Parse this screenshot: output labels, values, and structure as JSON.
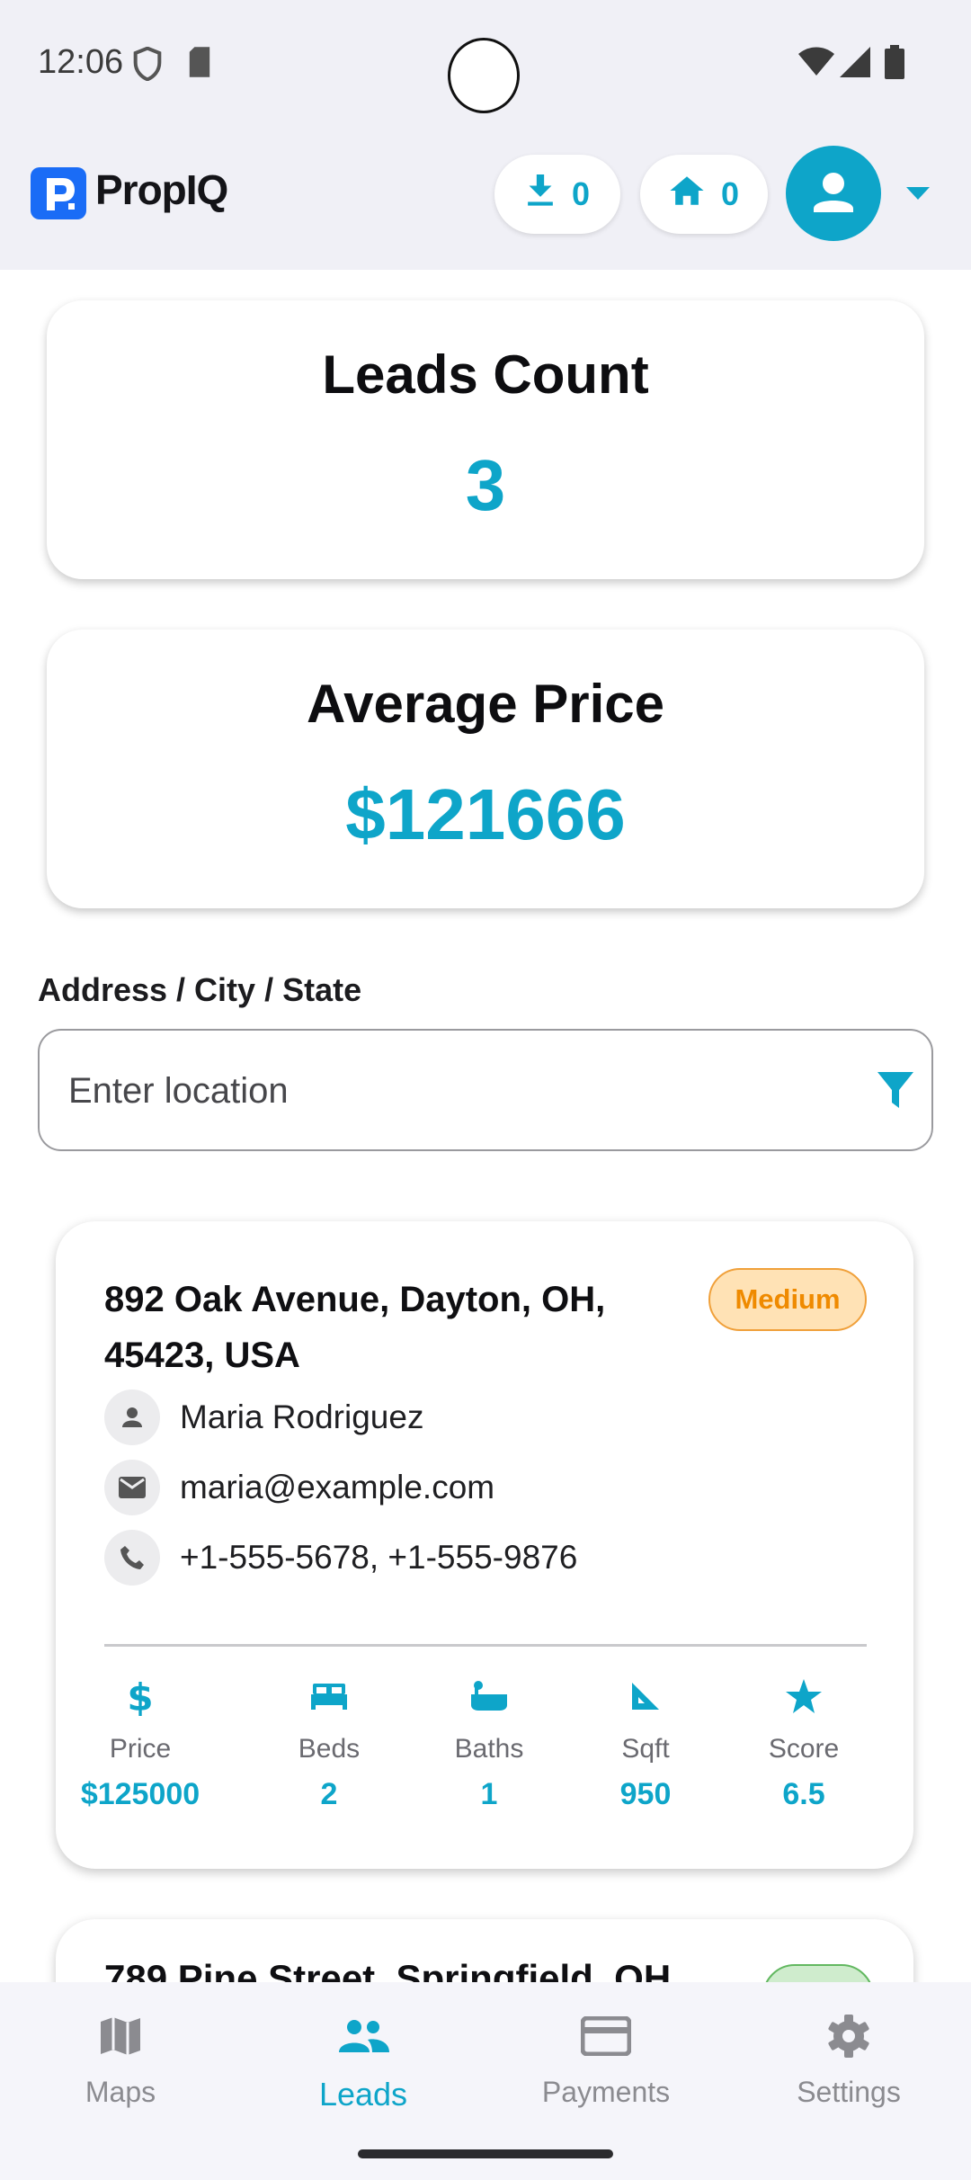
{
  "status_bar": {
    "time": "12:06"
  },
  "header": {
    "logo_mark": "P",
    "app_name": "PropIQ",
    "download_count": "0",
    "home_count": "0"
  },
  "stats": {
    "leads_title": "Leads Count",
    "leads_value": "3",
    "avg_title": "Average Price",
    "avg_value": "$121666"
  },
  "filter": {
    "label": "Address / City / State",
    "placeholder": "Enter location"
  },
  "leads": [
    {
      "address": "892 Oak Avenue, Dayton, OH, 45423, USA",
      "priority": "Medium",
      "name": "Maria Rodriguez",
      "email": "maria@example.com",
      "phones": "+1-555-5678, +1-555-9876",
      "metrics": {
        "price_label": "Price",
        "price": "$125000",
        "beds_label": "Beds",
        "beds": "2",
        "baths_label": "Baths",
        "baths": "1",
        "sqft_label": "Sqft",
        "sqft": "950",
        "score_label": "Score",
        "score": "6.5"
      }
    },
    {
      "address_visible": "789 Pine Street, Springfield, OH"
    }
  ],
  "nav": {
    "maps": "Maps",
    "leads": "Leads",
    "payments": "Payments",
    "settings": "Settings"
  },
  "colors": {
    "accent": "#0ea5c9",
    "brand_blue": "#1a6cf6",
    "priority_medium": "#ef8a00"
  }
}
